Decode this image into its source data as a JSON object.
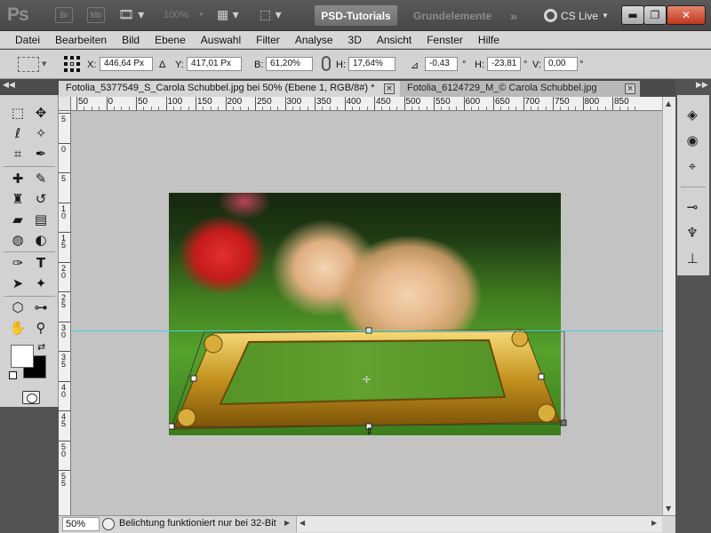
{
  "app": {
    "logo": "Ps",
    "bridge_badge": "Br",
    "minibridge_badge": "Mb",
    "zoom_level": "100%",
    "workspaces": {
      "active": "PSD-Tutorials",
      "other": "Grundelemente",
      "more": "»"
    },
    "cs_live": "CS Live",
    "window_buttons": {
      "minimize": "▬",
      "restore": "❐",
      "close": "✕"
    }
  },
  "menu": {
    "items": [
      "Datei",
      "Bearbeiten",
      "Bild",
      "Ebene",
      "Auswahl",
      "Filter",
      "Analyse",
      "3D",
      "Ansicht",
      "Fenster",
      "Hilfe"
    ]
  },
  "options_bar": {
    "x_label": "X:",
    "x_value": "446,64 Px",
    "delta_label": "Δ",
    "y_label": "Y:",
    "y_value": "417,01 Px",
    "w_label": "B:",
    "w_value": "61,20%",
    "h_label": "H:",
    "h_value": "17,64%",
    "angle_label": "⊿",
    "angle_value": "-0,43",
    "angle_unit": "°",
    "hskew_label": "H:",
    "hskew_value": "-23,81",
    "hskew_unit": "°",
    "vskew_label": "V:",
    "vskew_value": "0,00",
    "vskew_unit": "°"
  },
  "documents": {
    "tabs": [
      {
        "title": "Fotolia_5377549_S_Carola Schubbel.jpg bei 50% (Ebene 1, RGB/8#) *",
        "active": true
      },
      {
        "title": "Fotolia_6124729_M_© Carola Schubbel.jpg",
        "active": false
      }
    ],
    "close_glyph": "×"
  },
  "rulers": {
    "top_labels": [
      "50",
      "0",
      "50",
      "100",
      "150",
      "200",
      "250",
      "300",
      "350",
      "400",
      "450",
      "500",
      "550",
      "600",
      "650",
      "700",
      "750",
      "800",
      "850"
    ],
    "left_labels": [
      "5",
      "0",
      "5",
      "1 0",
      "1 5",
      "2 0",
      "2 5",
      "3 0",
      "3 5",
      "4 0",
      "4 5",
      "5 0",
      "5 5"
    ]
  },
  "toolbar": {
    "tools": [
      {
        "name": "marquee-tool",
        "glyph": "⬚"
      },
      {
        "name": "move-tool",
        "glyph": "✥"
      },
      {
        "name": "lasso-tool",
        "glyph": "ℓ"
      },
      {
        "name": "magic-wand-tool",
        "glyph": "✧"
      },
      {
        "name": "crop-tool",
        "glyph": "⌗"
      },
      {
        "name": "eyedropper-tool",
        "glyph": "✒"
      },
      {
        "name": "healing-brush-tool",
        "glyph": "✚"
      },
      {
        "name": "brush-tool",
        "glyph": "✎"
      },
      {
        "name": "clone-stamp-tool",
        "glyph": "♜"
      },
      {
        "name": "history-brush-tool",
        "glyph": "↺"
      },
      {
        "name": "eraser-tool",
        "glyph": "▰"
      },
      {
        "name": "gradient-tool",
        "glyph": "▤"
      },
      {
        "name": "blur-tool",
        "glyph": "◍"
      },
      {
        "name": "dodge-tool",
        "glyph": "◐"
      },
      {
        "name": "pen-tool",
        "glyph": "✑"
      },
      {
        "name": "type-tool",
        "glyph": "T"
      },
      {
        "name": "path-selection-tool",
        "glyph": "➤"
      },
      {
        "name": "custom-shape-tool",
        "glyph": "✦"
      },
      {
        "name": "3d-rotate-tool",
        "glyph": "⬡"
      },
      {
        "name": "3d-camera-tool",
        "glyph": "⊶"
      },
      {
        "name": "hand-tool",
        "glyph": "✋"
      },
      {
        "name": "zoom-tool",
        "glyph": "⚲"
      }
    ]
  },
  "right_panel": {
    "icons": [
      {
        "name": "layers-icon",
        "glyph": "◈"
      },
      {
        "name": "channels-icon",
        "glyph": "◉"
      },
      {
        "name": "paths-icon",
        "glyph": "⌖"
      },
      {
        "name": "adjustments-icon",
        "glyph": "⊸"
      },
      {
        "name": "puppet-icon",
        "glyph": "♆"
      },
      {
        "name": "stamp-icon",
        "glyph": "⊥"
      }
    ]
  },
  "status": {
    "zoom": "50%",
    "text": "Belichtung funktioniert nur bei 32-Bit"
  },
  "colors": {
    "guide": "#46d3de",
    "workspace": "#c3c3c3",
    "active_workspace_tab": "#7d7d7d",
    "close_button": "#c1361e"
  }
}
